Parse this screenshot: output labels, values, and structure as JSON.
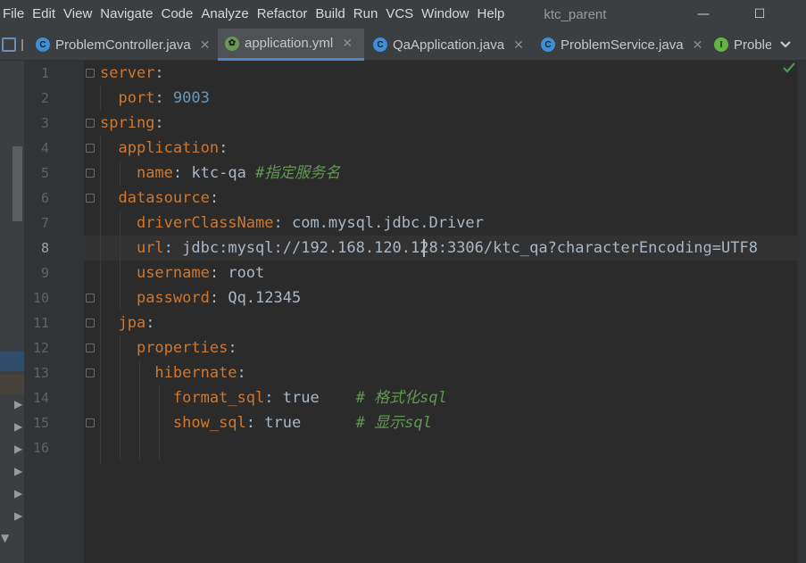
{
  "menu": {
    "items": [
      "File",
      "Edit",
      "View",
      "Navigate",
      "Code",
      "Analyze",
      "Refactor",
      "Build",
      "Run",
      "VCS",
      "Window",
      "Help"
    ],
    "project_title": "ktc_parent"
  },
  "window_controls": {
    "minimize": "—",
    "maximize": "☐",
    "close": "✕"
  },
  "tabs": [
    {
      "label": "ProblemController.java",
      "icon": "java-class-icon",
      "active": false
    },
    {
      "label": "application.yml",
      "icon": "yaml-spring-icon",
      "active": true
    },
    {
      "label": "QaApplication.java",
      "icon": "java-spring-class-icon",
      "active": false
    },
    {
      "label": "ProblemService.java",
      "icon": "java-class-icon",
      "active": false
    },
    {
      "label": "Proble",
      "icon": "java-interface-icon",
      "active": false
    }
  ],
  "editor": {
    "current_line": 8,
    "line_numbers": [
      "1",
      "2",
      "3",
      "4",
      "5",
      "6",
      "7",
      "8",
      "9",
      "10",
      "11",
      "12",
      "13",
      "14",
      "15",
      "16"
    ],
    "lines": [
      {
        "key": "server",
        "sep": ":",
        "val": "",
        "comment": ""
      },
      {
        "key": "port",
        "sep": ": ",
        "val": "9003",
        "comment": ""
      },
      {
        "key": "spring",
        "sep": ":",
        "val": "",
        "comment": ""
      },
      {
        "key": "application",
        "sep": ":",
        "val": "",
        "comment": ""
      },
      {
        "key": "name",
        "sep": ": ",
        "val": "ktc-qa ",
        "comment": "#指定服务名"
      },
      {
        "key": "datasource",
        "sep": ":",
        "val": "",
        "comment": ""
      },
      {
        "key": "driverClassName",
        "sep": ": ",
        "val": "com.mysql.jdbc.Driver",
        "comment": ""
      },
      {
        "key": "url",
        "sep": ": ",
        "val": "jdbc:mysql://192.168.120.128:3306/ktc_qa?characterEncoding=UTF8",
        "comment": ""
      },
      {
        "key": "username",
        "sep": ": ",
        "val": "root",
        "comment": ""
      },
      {
        "key": "password",
        "sep": ": ",
        "val": "Qq.12345",
        "comment": ""
      },
      {
        "key": "jpa",
        "sep": ":",
        "val": "",
        "comment": ""
      },
      {
        "key": "properties",
        "sep": ":",
        "val": "",
        "comment": ""
      },
      {
        "key": "hibernate",
        "sep": ":",
        "val": "",
        "comment": ""
      },
      {
        "key": "format_sql",
        "sep": ": ",
        "val": "true    ",
        "comment": "# 格式化sql"
      },
      {
        "key": "show_sql",
        "sep": ": ",
        "val": "true      ",
        "comment": "# 显示sql"
      }
    ]
  },
  "colors": {
    "keyword": "#cc7832",
    "number": "#6897bb",
    "comment": "#629755",
    "accent": "#4a88c7",
    "check": "#499c54"
  }
}
